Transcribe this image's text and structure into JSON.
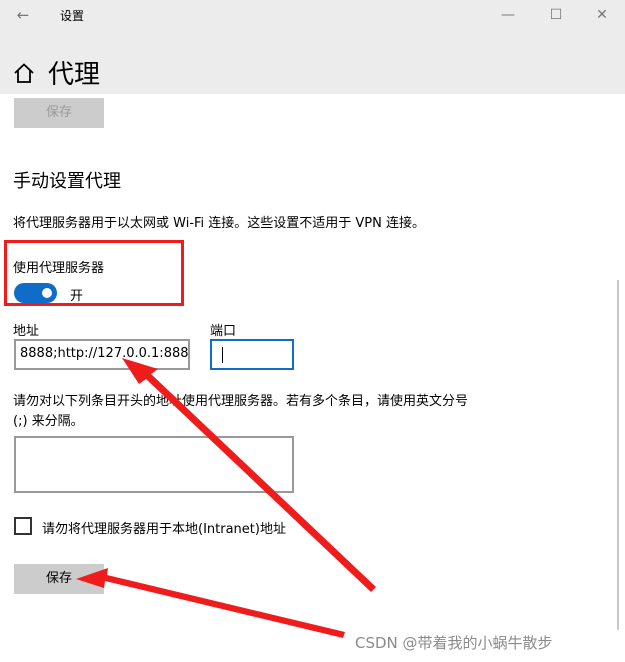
{
  "window": {
    "title": "设置",
    "back_icon": "←",
    "minimize_icon": "—",
    "maximize_icon": "☐",
    "close_icon": "✕"
  },
  "page": {
    "title": "代理"
  },
  "top_save_button": {
    "label": "保存",
    "state": "disabled"
  },
  "manual_proxy": {
    "section_title": "手动设置代理",
    "description": "将代理服务器用于以太网或 Wi-Fi 连接。这些设置不适用于 VPN 连接。",
    "use_proxy_label": "使用代理服务器",
    "toggle_state_label": "开",
    "toggle_on": true,
    "address_label": "地址",
    "address_value": "8888;http://127.0.0.1:8888",
    "port_label": "端口",
    "port_value": "",
    "exceptions_description": "请勿对以下列条目开头的地址使用代理服务器。若有多个条目，请使用英文分号 (;) 来分隔。",
    "exceptions_value": "",
    "local_bypass_label": "请勿将代理服务器用于本地(Intranet)地址",
    "local_bypass_checked": false,
    "save_label": "保存"
  },
  "watermark": "CSDN @带着我的小蜗牛散步",
  "colors": {
    "accent": "#0f6cc9",
    "annotation_red": "#ef1c1c",
    "header_bg": "#ececec",
    "button_bg": "#cccccc"
  }
}
